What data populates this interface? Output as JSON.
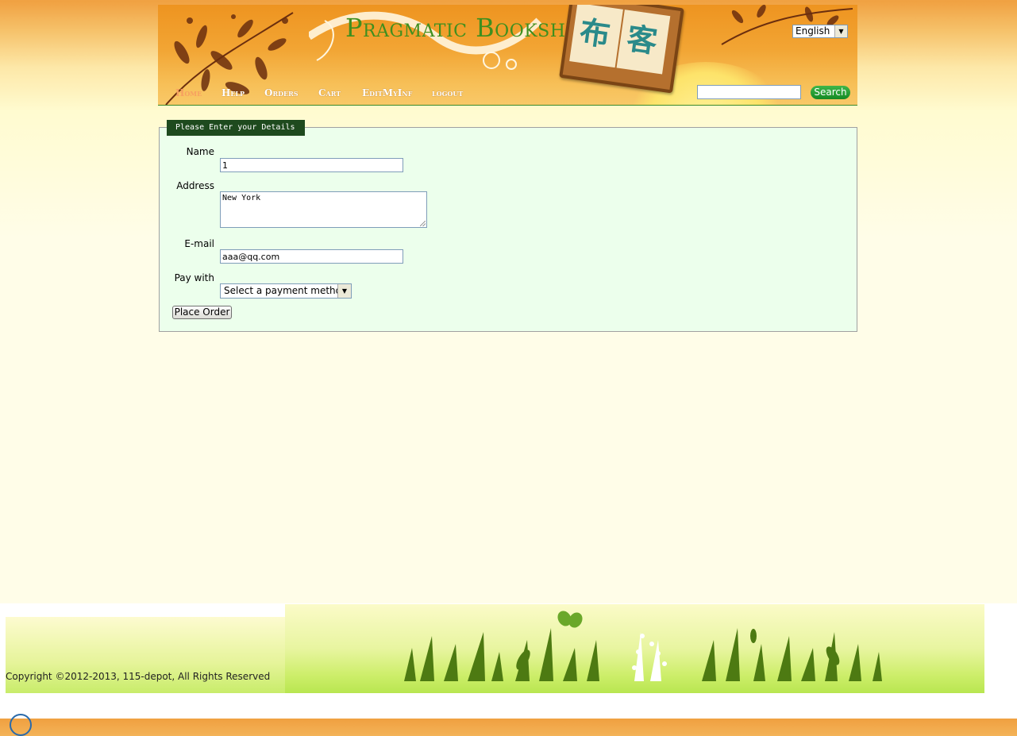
{
  "header": {
    "site_title": "Pragmatic Bookshelf",
    "sign_chars": [
      "布",
      "客"
    ],
    "language": "English",
    "nav": [
      "Home",
      "Help",
      "Orders",
      "Cart",
      "EditMyInf",
      "logout"
    ],
    "search_placeholder": "",
    "search_button": "Search"
  },
  "form": {
    "legend": "Please Enter your Details",
    "fields": {
      "name_label": "Name",
      "name_value": "1",
      "address_label": "Address",
      "address_value": "New York",
      "email_label": "E-mail",
      "email_value": "aaa@qq.com",
      "pay_label": "Pay with",
      "pay_value": "Select a payment method"
    },
    "submit": "Place Order"
  },
  "footer": {
    "copyright": "Copyright ©2012-2013, 115-depot, All Rights Reserved"
  },
  "colors": {
    "accent_green": "#3f8f1e",
    "banner_orange": "#ee9420",
    "form_bg": "#ecffec",
    "legend_bg": "#1e4a1e"
  }
}
